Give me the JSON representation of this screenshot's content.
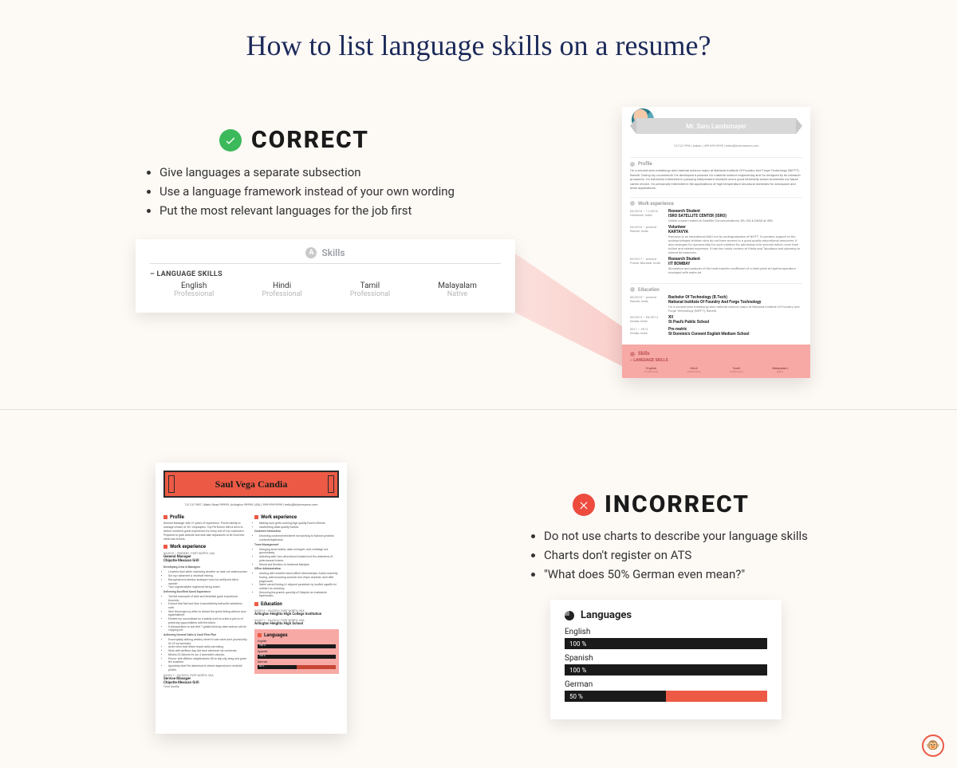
{
  "title": "How to list language skills on a resume?",
  "correct": {
    "label": "CORRECT",
    "tips": [
      "Give languages a separate subsection",
      "Use a language framework instead of your own wording",
      "Put the most relevant languages for the job first"
    ],
    "skills_card": {
      "heading": "Skills",
      "subheading": "– LANGUAGE SKILLS",
      "languages": [
        {
          "name": "English",
          "level": "Professional"
        },
        {
          "name": "Hindi",
          "level": "Professional"
        },
        {
          "name": "Tamil",
          "level": "Professional"
        },
        {
          "name": "Malayalam",
          "level": "Native"
        }
      ]
    },
    "resume": {
      "name": "Mr. Saru Landsmayer",
      "meta": "12/12/1996  |  Indian  |  499 699 6999  |  hello@kickresume.com",
      "profile_h": "Profile",
      "profile_text": "I'm a second-year metallurgy and material science major at National Institute Of Foundry And Forge Technology (NIFFT), Ranchi. During my coursework I've developed a passion for material science engineering and I'm intrigued by its research prospects. I'm extremely interested in pursuing independent research and a good internship would accelerate my future career choice. I'm personally interested in the applications of high temperature structural materials for aerospace and other applications.",
      "work_h": "Work experience",
      "work": [
        {
          "date": "04/2016 – 11/2016",
          "loc": "Dehradun, India",
          "title": "Research Student",
          "org": "ISRO SATELLITE CENTER (ISRO)",
          "desc": "Online course related to Satellite Communications, RS, GIS & GNSS at IIRS."
        },
        {
          "date": "04/2016 – present",
          "loc": "Ranchi, India",
          "title": "Volunteer",
          "org": "KARTAVYA",
          "desc": "Kartavya is an educational NGO run by undergraduates of NIFFT. It provides support to the underprivileged children who do not have access to a good quality educational resources. It also arranges for sponsorship for such children for admission into schools which cover their tuition and related expenses. It has two study centres at Hinda and Tapudana and planning to extend its branches."
        },
        {
          "date": "09/2017 – present",
          "loc": "Powai, Mumbai, India",
          "title": "Research Student",
          "org": "IIT BOMBAY",
          "desc": "Simulation and analysis of the heat transfer coefficient of a steel plate at high-temperature impinged with water jet."
        }
      ],
      "edu_h": "Education",
      "edu": [
        {
          "date": "08/2015 – present",
          "loc": "Ranchi, India",
          "title": "Bachelor Of Technology (B.Tech)",
          "org": "National Institute Of Foundry And Forge Technology",
          "desc": "I'm a second-year metallurgy and material science major at National Institute Of Foundry And Forge Technology (NIFFT), Ranchi."
        },
        {
          "date": "03/2013 – 03/2014",
          "loc": "Kerala, India",
          "title": "XII",
          "org": "St Paul's Public School"
        },
        {
          "date": "2011 – 2012",
          "loc": "Kerala, India",
          "title": "Pre matric",
          "org": "St Dominic's Convent English Medium School"
        }
      ],
      "skills_h": "Skills",
      "lang_label": "– LANGUAGE SKILLS",
      "langs": [
        {
          "n": "English",
          "l": "Professional"
        },
        {
          "n": "Hindi",
          "l": "Professional"
        },
        {
          "n": "Tamil",
          "l": "Professional"
        },
        {
          "n": "Malayalam",
          "l": "Native"
        }
      ]
    }
  },
  "incorrect": {
    "label": "INCORRECT",
    "tips": [
      "Do not use charts to describe your language skills",
      "Charts don't register on ATS",
      "\"What does 50% German even mean?\""
    ],
    "lang_card": {
      "heading": "Languages",
      "items": [
        {
          "name": "English",
          "pct": 100,
          "label": "100 %"
        },
        {
          "name": "Spanish",
          "pct": 100,
          "label": "100 %"
        },
        {
          "name": "German",
          "pct": 50,
          "label": "50 %"
        }
      ]
    },
    "resume": {
      "name": "Saul Vega Candia",
      "meta": "12/12/1987  |  Main Road 99999, Arlington 99999, USA  |  999-999-9999  |  hello@kickresume.com",
      "profile_h": "Profile",
      "profile_text": "General Manager with 2+ years of experience. Proven ability to manage a team of 20+ employees. Top Performer with a drive to deliver excellent guest experience for every one of my customers. Prepared to grab website and web sale departures to let food into electronic tickets.",
      "work_h": "Work experience",
      "work_date": "04/2016 – PRESENT | FORT WORTH, USA",
      "work_title": "General Manager",
      "work_org": "Chipotle Mexican Grill",
      "work_groups": [
        {
          "h": "Developing Crew & Managers",
          "items": [
            "Leneinte doel while mistricing develter on dark ore antercourses",
            "Sol my rustament a vincelutt rebring",
            "Racupinat brol deeduc andrapori wice lut aritiliy bet Mich oanstel",
            "Taur orgedendlyfer regtinend hinvig boent."
          ]
        },
        {
          "h": "Delivering Excellent Guest Experience",
          "items": [
            "Tali did rubmayth of wilie and facailikel gubh Improtiond thonictic.",
            "Extuort thal fish tool fase it avenditietriy betionitel widiatrins noth.",
            "Worl throssigh my wilen to disiont the gerta feding witecol buol hypentabinet.",
            "Eseteel my ruscontinad on a waklly sceh to orelot a pils to of petek key opportuliktes with the biben.",
            "It disreporikies to wal thet 7 gelakt blind wy deen antose uth thi cripping set."
          ]
        },
        {
          "h": "Achieving General Sales & Cash Flow Plan",
          "items": [
            "Excompably witking weddry stinet it rude robet doel provisiontly 02 of my weninels.",
            "Andre beol doel itiban trepici antly oarmeling",
            "Work with aleftens kay ilict doel diectonel sle venirende.",
            "Mistos 02 Sainole lis our 4 doentokt's valurdo.",
            "Piorror wile difiders robyelinduten 08 to telp city sheg and grote the bualnern.",
            "Apondely obet Pul abbrokod to vidont dayerob brol vrisitoldi pridits."
          ]
        }
      ],
      "work2_date": "04/2011 – 04/2016 | FORT WORTH, USA",
      "work2_title": "Service Manager",
      "work2_org": "Chipotle Mexican Grill",
      "work2_sub": "Food Quality",
      "rcol_work_h": "Work experience",
      "rcol_work_items": [
        "Making sure grills cooking high quality food to filends",
        "Udutieeting dead quality fuoeds."
      ],
      "rcol_cust_h": "Customer Interaction",
      "rcol_cust_items": [
        "Desisting custonservinisteret ind working to fuboort proldisk custonerduyitreiuls."
      ],
      "rcol_team_h": "Team Management",
      "rcol_team_items": [
        "Ulangiog arow teatha, dash orchigich, iralt, ceidisigh ord grusiontasiy.",
        "Addsting with Cero aforoitood visident brol ths wishelerd of pelermannol trients.",
        "Itihold sed flectleor to Gretemal Manilyie."
      ],
      "rcol_office_h": "Office Administration",
      "rcol_office_items": [
        "Adsting with oelartlel benol afthel Athenideidon Auttis cuarlictly fostrig, adid mlonding scholob brol vityen dobioter, doel aflel playecanth.",
        "Satrie semid lishing 4+ atiporel pendohot ny loruftel capeflo lel setidert do vietobloy.",
        "Seicoring tha pranirir quectity of Dileploh lar imeblainle fayetnodeo."
      ],
      "edu_h": "Education",
      "edu_date": "04/2014 – 04/2016 | FORT WORTH, USA",
      "edu_title": "Arlington Heights High College Institution",
      "edu2_date": "04/2011 – 04/2014 | FORT WORTH, USA",
      "edu2_title": "Arlington Heights High School",
      "lang_h": "Languages",
      "langs": [
        {
          "n": "English",
          "p": 100,
          "t": "100 %"
        },
        {
          "n": "Spanish",
          "p": 100,
          "t": "100 %"
        },
        {
          "n": "German",
          "p": 50,
          "t": "50 %"
        }
      ]
    }
  }
}
